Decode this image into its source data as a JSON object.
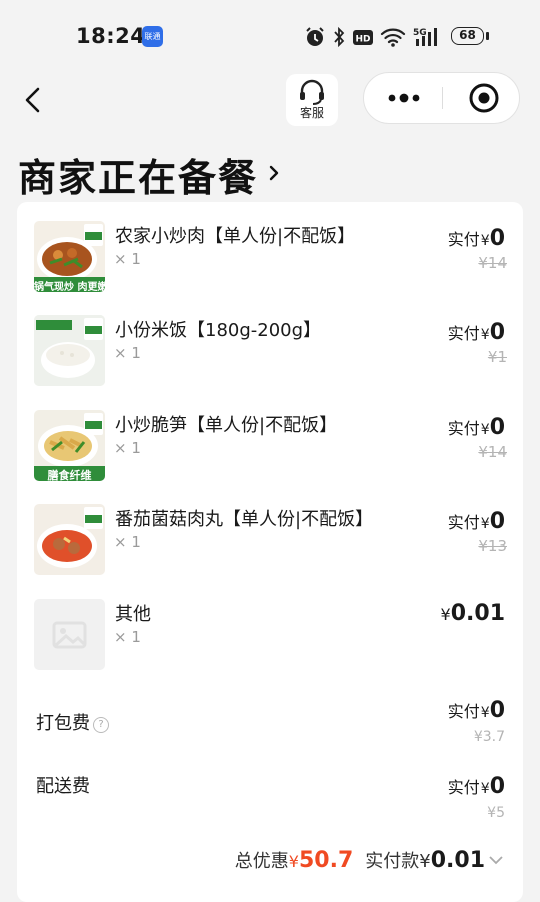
{
  "status_bar": {
    "time": "18:24",
    "app_badge": "联通",
    "battery": "68"
  },
  "nav": {
    "service_label": "客服"
  },
  "page": {
    "title": "商家正在备餐"
  },
  "items": [
    {
      "name": "农家小炒肉【单人份|不配饭】",
      "qty": "× 1",
      "paid_label": "实付",
      "currency": "¥",
      "paid": "0",
      "original": "¥14",
      "thumb_caption": "锅气现炒 肉更嫩"
    },
    {
      "name": "小份米饭【180g-200g】",
      "qty": "× 1",
      "paid_label": "实付",
      "currency": "¥",
      "paid": "0",
      "original": "¥1",
      "thumb_caption": ""
    },
    {
      "name": "小炒脆笋【单人份|不配饭】",
      "qty": "× 1",
      "paid_label": "实付",
      "currency": "¥",
      "paid": "0",
      "original": "¥14",
      "thumb_caption": "膳食纤维"
    },
    {
      "name": "番茄菌菇肉丸【单人份|不配饭】",
      "qty": "× 1",
      "paid_label": "实付",
      "currency": "¥",
      "paid": "0",
      "original": "¥13",
      "thumb_caption": ""
    },
    {
      "name": "其他",
      "qty": "× 1",
      "currency": "¥",
      "price": "0.01"
    }
  ],
  "fees": {
    "packing": {
      "label": "打包费",
      "help_icon": "question-circle-icon",
      "paid_label": "实付",
      "currency": "¥",
      "paid": "0",
      "original": "¥3.7"
    },
    "delivery": {
      "label": "配送费",
      "paid_label": "实付",
      "currency": "¥",
      "paid": "0",
      "original": "¥5"
    }
  },
  "summary": {
    "discount_label": "总优惠",
    "discount_currency": "¥",
    "discount": "50.7",
    "total_label": "实付款",
    "total_currency": "¥",
    "total": "0.01"
  },
  "colors": {
    "accent": "#f04a22",
    "background": "#f3f3f3",
    "card": "#ffffff",
    "strike": "#b4b4b4",
    "badge": "#2f6ee8"
  }
}
